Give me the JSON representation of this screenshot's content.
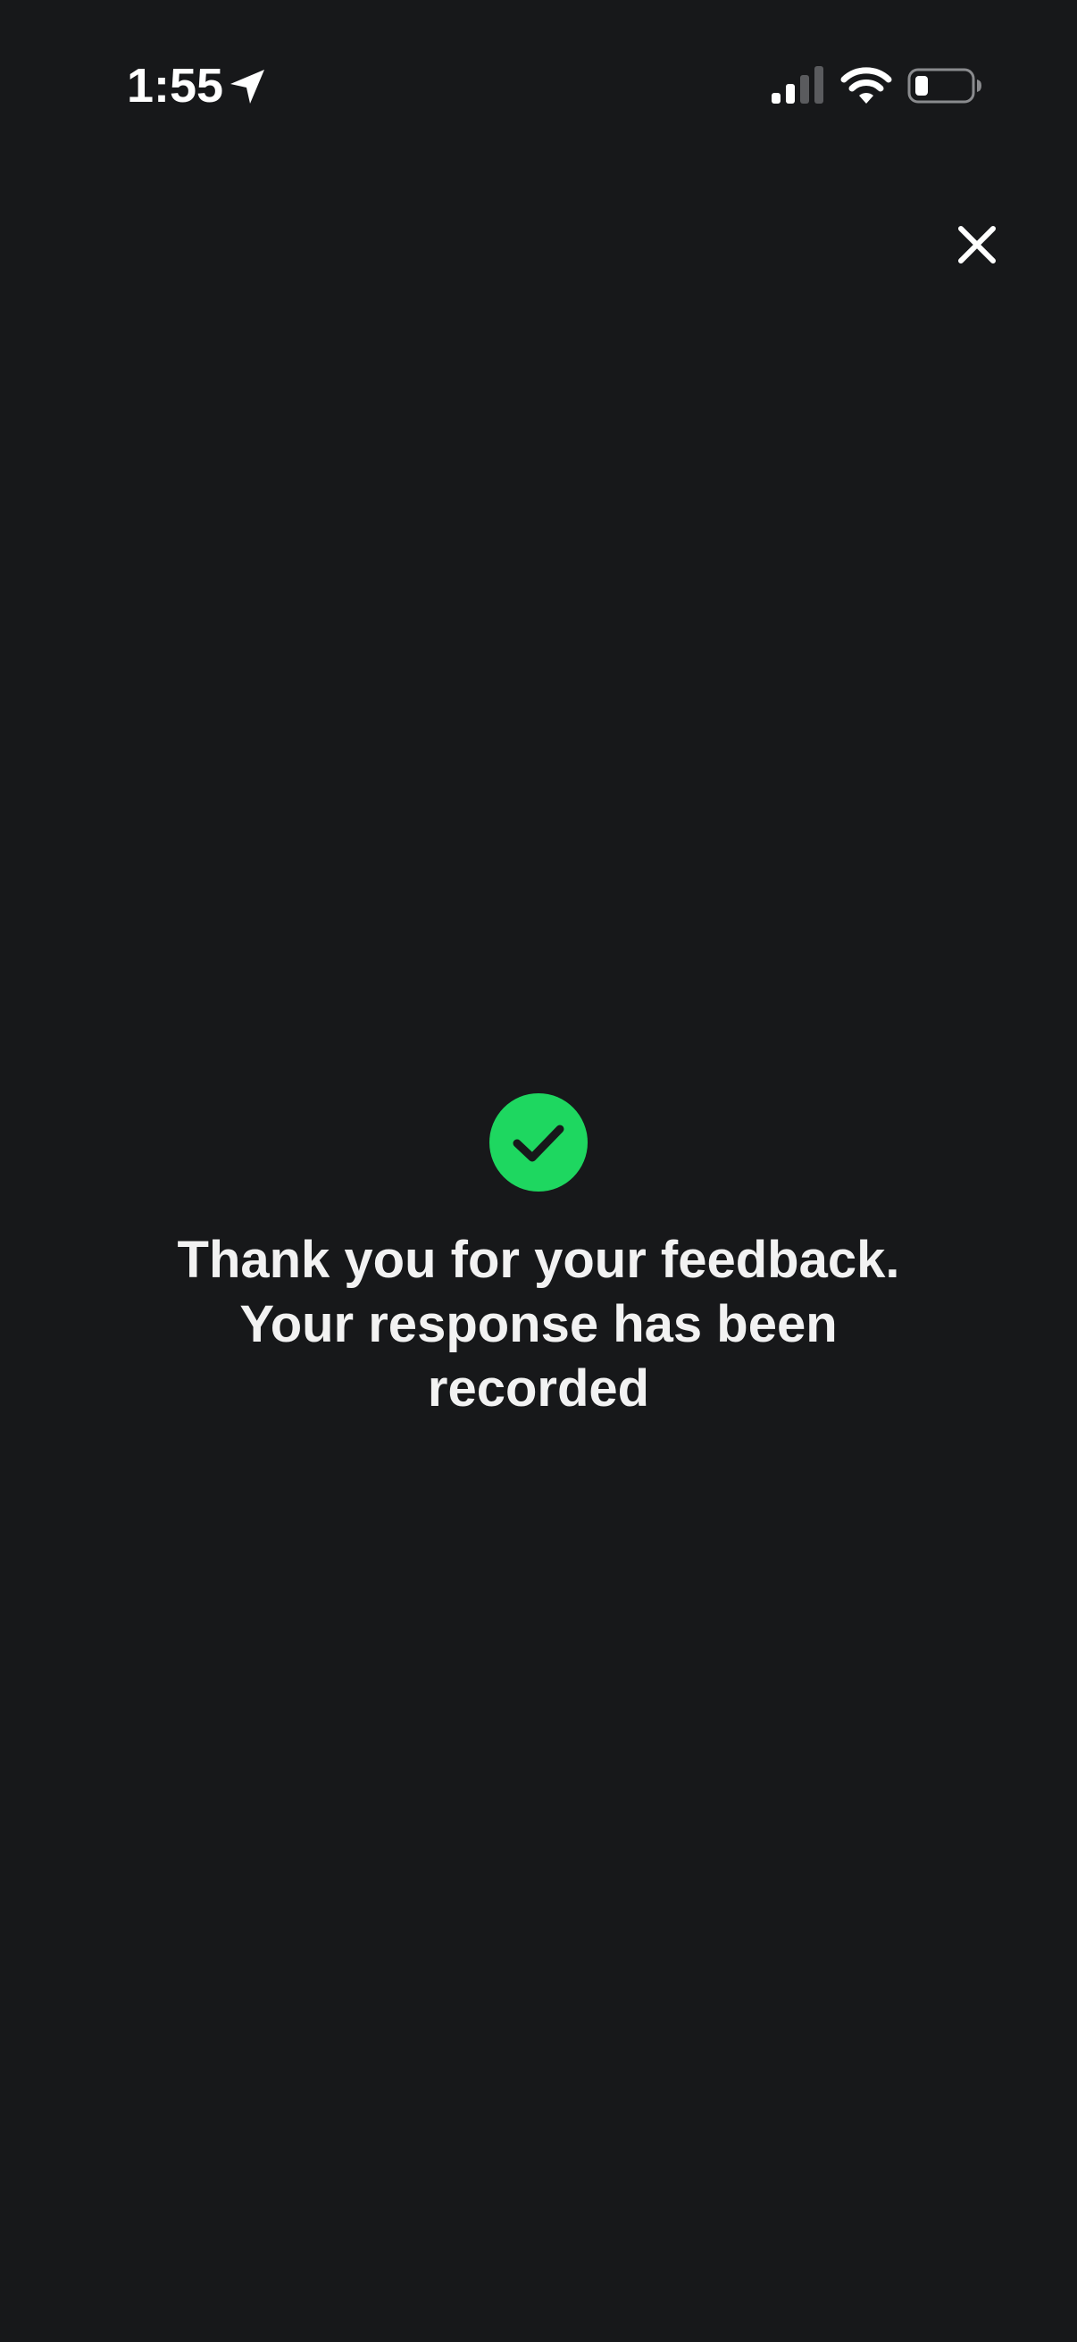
{
  "status_bar": {
    "time": "1:55",
    "location_icon": "location-arrow",
    "signal_icon": "cellular-signal-2-of-4",
    "wifi_icon": "wifi",
    "battery_icon": "battery-low"
  },
  "close_icon": "close-x",
  "confirmation": {
    "icon": "check-circle",
    "icon_color": "#1ed760",
    "lines": [
      "Thank you for your feedback.",
      "Your response has been",
      "recorded"
    ]
  },
  "colors": {
    "background": "#17181a",
    "text": "#f2f2f2"
  }
}
